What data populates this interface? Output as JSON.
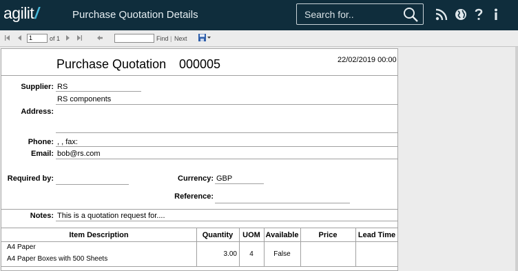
{
  "app": {
    "logo_text": "agilit",
    "logo_slash": "/",
    "title": "Purchase Quotation Details"
  },
  "search": {
    "placeholder": "Search for.."
  },
  "top_icons": [
    "rss-icon",
    "globe-icon",
    "help-icon",
    "info-icon"
  ],
  "toolbar": {
    "page_value": "1",
    "of_label": "of 1",
    "find_label": "Find",
    "separator": "|",
    "next_label": "Next"
  },
  "report": {
    "title": "Purchase Quotation",
    "number": "000005",
    "date": "22/02/2019 00:00",
    "supplier_label": "Supplier:",
    "supplier_code": "RS",
    "supplier_name": "RS components",
    "address_label": "Address:",
    "phone_label": "Phone:",
    "phone_value": ", ,  fax:",
    "email_label": "Email:",
    "email_value": "bob@rs.com",
    "required_by_label": "Required by:",
    "required_by_value": "",
    "currency_label": "Currency:",
    "currency_value": "GBP",
    "reference_label": "Reference:",
    "reference_value": "",
    "notes_label": "Notes:",
    "notes_value": "This is a quotation request for....",
    "table": {
      "headers": [
        "Item Description",
        "Quantity",
        "UOM",
        "Available",
        "Price",
        "Lead Time"
      ],
      "rows": [
        {
          "description_line1": "A4 Paper",
          "description_line2": "A4 Paper Boxes with 500 Sheets",
          "quantity": "3.00",
          "uom": "4",
          "available": "False",
          "price": "",
          "lead_time": ""
        }
      ]
    }
  },
  "colors": {
    "topbar": "#0f2d3c",
    "accent": "#46b7d9",
    "toolbar": "#ececec"
  }
}
